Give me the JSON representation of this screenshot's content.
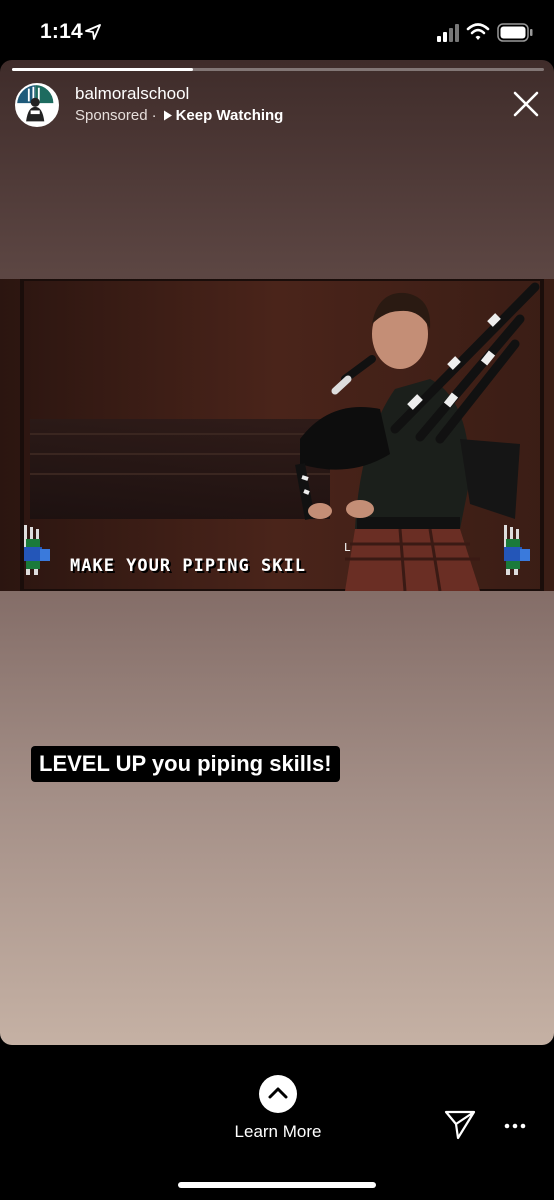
{
  "status_bar": {
    "time": "1:14",
    "icons": [
      "location-arrow-icon",
      "cellular-signal-icon",
      "wifi-icon",
      "battery-icon"
    ]
  },
  "story": {
    "progress": 0.34,
    "account_name": "balmoralschool",
    "sponsored_label": "Sponsored",
    "separator": "·",
    "keep_watching_label": "Keep Watching",
    "close_icon": "close-icon",
    "video": {
      "caption": "MAKE YOUR PIPING SKIL",
      "caption_tail": "L"
    },
    "text_sticker": "LEVEL UP you piping skills!"
  },
  "bottom_bar": {
    "cta_label": "Learn More",
    "cta_icon": "chevron-up-icon",
    "send_icon": "send-icon",
    "more_icon": "more-icon"
  },
  "colors": {
    "background": "#000000",
    "story_top": "#3f2c2a",
    "story_bottom": "#c5b1a4",
    "sticker_bg": "#000000",
    "tartan": "#7a3a2c"
  }
}
